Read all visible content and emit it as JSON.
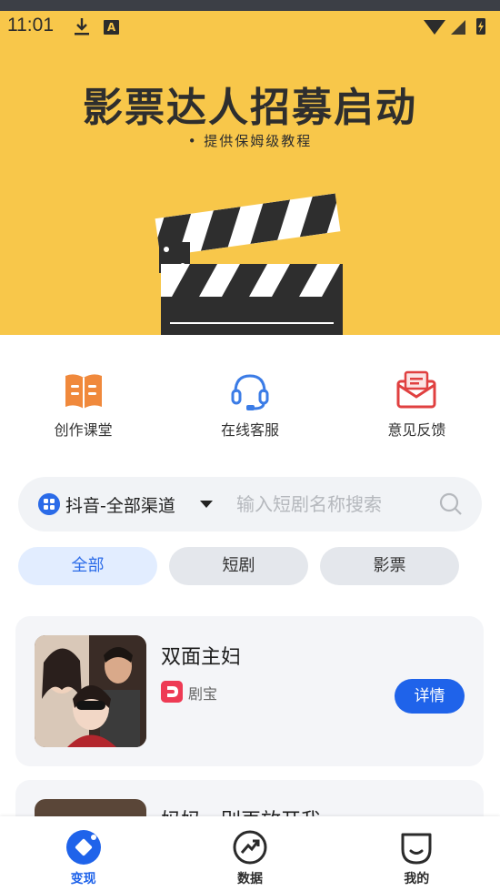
{
  "status_bar": {
    "time": "11:01",
    "a_badge": "A"
  },
  "banner": {
    "title": "影票达人招募启动",
    "subtitle": "•  提供保姆级教程"
  },
  "quick_actions": [
    {
      "label": "创作课堂",
      "icon": "book-icon"
    },
    {
      "label": "在线客服",
      "icon": "headset-icon"
    },
    {
      "label": "意见反馈",
      "icon": "mail-icon"
    }
  ],
  "search": {
    "channel": "抖音-全部渠道",
    "placeholder": "输入短剧名称搜索"
  },
  "tabs": [
    {
      "label": "全部",
      "active": true
    },
    {
      "label": "短剧",
      "active": false
    },
    {
      "label": "影票",
      "active": false
    }
  ],
  "cards": [
    {
      "title": "双面主妇",
      "platform": "剧宝",
      "action": "详情"
    },
    {
      "title": "妈妈，别再放开我"
    }
  ],
  "bottom_nav": [
    {
      "label": "变现",
      "icon": "monetize-icon",
      "active": true
    },
    {
      "label": "数据",
      "icon": "chart-up-icon",
      "active": false
    },
    {
      "label": "我的",
      "icon": "profile-icon",
      "active": false
    }
  ],
  "colors": {
    "banner_bg": "#f8c74a",
    "accent": "#1f63ea",
    "platform": "#ee3a54",
    "card_bg": "#f4f5f8"
  }
}
